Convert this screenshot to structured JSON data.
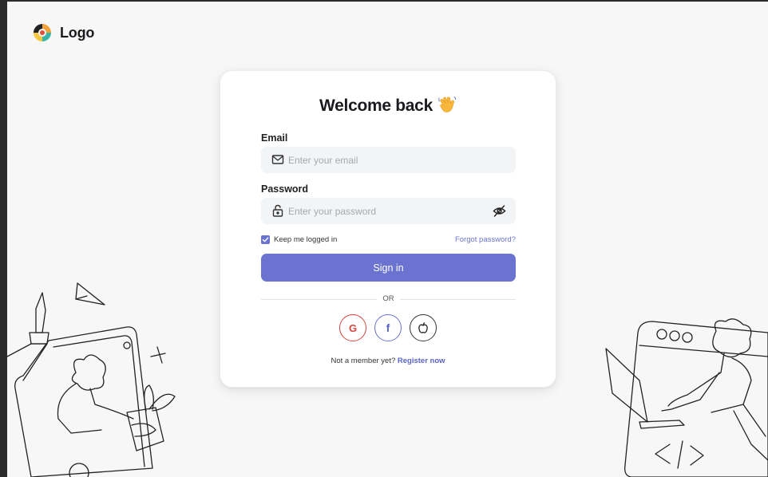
{
  "brand": {
    "name": "Logo"
  },
  "login": {
    "title": "Welcome back",
    "email_label": "Email",
    "email_placeholder": "Enter your email",
    "password_label": "Password",
    "password_placeholder": "Enter your password",
    "remember_label": "Keep me logged in",
    "remember_checked": true,
    "forgot_label": "Forgot password?",
    "signin_label": "Sign in",
    "divider_text": "OR",
    "socials": [
      {
        "name": "google",
        "glyph": "G",
        "color": "#d6453d"
      },
      {
        "name": "facebook",
        "glyph": "f",
        "color": "#5b64c8"
      },
      {
        "name": "apple",
        "glyph": "apple-icon",
        "color": "#333333"
      }
    ],
    "register_prompt": "Not a member yet?",
    "register_link": "Register now"
  },
  "colors": {
    "accent": "#6b73d1",
    "background": "#f7f7f7",
    "card": "#ffffff"
  }
}
